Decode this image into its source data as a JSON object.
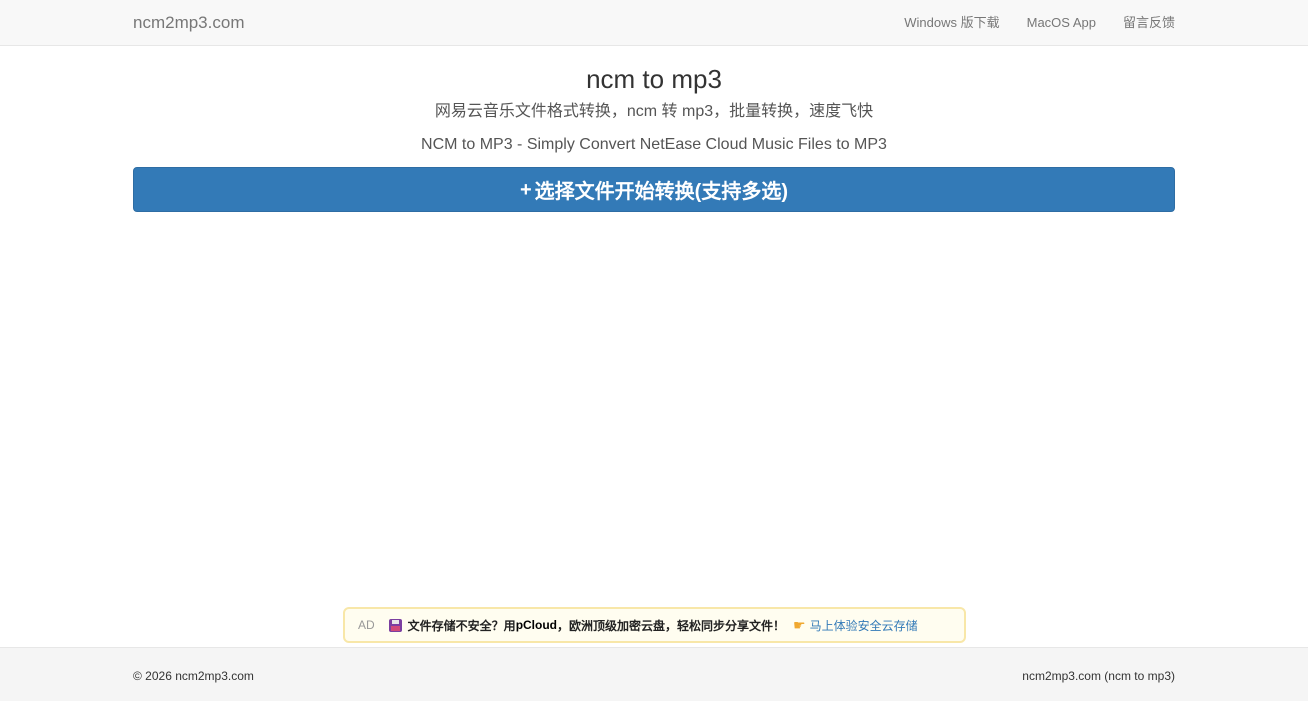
{
  "navbar": {
    "brand": "ncm2mp3.com",
    "links": [
      {
        "label": "Windows 版下载"
      },
      {
        "label": "MacOS App"
      },
      {
        "label": "留言反馈"
      }
    ]
  },
  "main": {
    "title": "ncm to mp3",
    "subtitle_cn": "网易云音乐文件格式转换，ncm 转 mp3，批量转换，速度飞快",
    "subtitle_en": "NCM to MP3 - Simply Convert NetEase Cloud Music Files to MP3",
    "convert_button": {
      "icon": "+",
      "label": "选择文件开始转换(支持多选)"
    }
  },
  "ad": {
    "tag": "AD",
    "text_before": "文件存储不安全？用 ",
    "brand": "pCloud",
    "text_after": "，欧洲顶级加密云盘，轻松同步分享文件！",
    "link_label": "马上体验安全云存储",
    "icons": [
      "floppy-disk-icon",
      "pointing-hand-icon"
    ]
  },
  "footer": {
    "copyright": "© 2026 ncm2mp3.com",
    "right_text": "ncm2mp3.com (ncm to mp3)"
  },
  "colors": {
    "primary": "#337ab7",
    "navbar_bg": "#f8f8f8",
    "footer_bg": "#f5f5f5",
    "ad_bg": "#fffdf0",
    "ad_border": "#f8e7a8"
  }
}
